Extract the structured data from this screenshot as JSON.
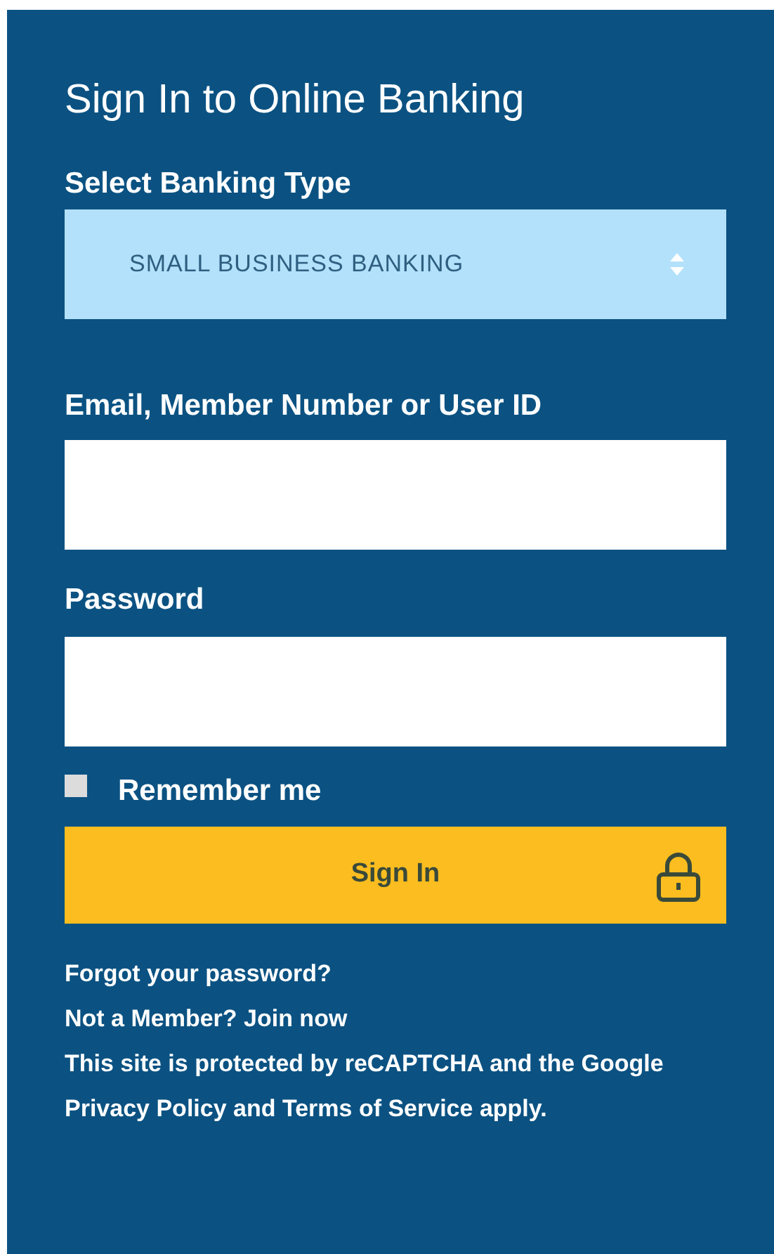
{
  "title": "Sign In to Online Banking",
  "banking_type": {
    "label": "Select Banking Type",
    "value": "SMALL BUSINESS BANKING"
  },
  "username": {
    "label": "Email, Member Number or User ID"
  },
  "password": {
    "label": "Password"
  },
  "remember_me": {
    "label": "Remember me",
    "checked": false
  },
  "sign_in_button": {
    "label": "Sign In"
  },
  "links": [
    "Forgot your password?",
    "Not a Member? Join now"
  ],
  "notice": "This site is protected by reCAPTCHA and the Google Privacy Policy and Terms of Service apply."
}
